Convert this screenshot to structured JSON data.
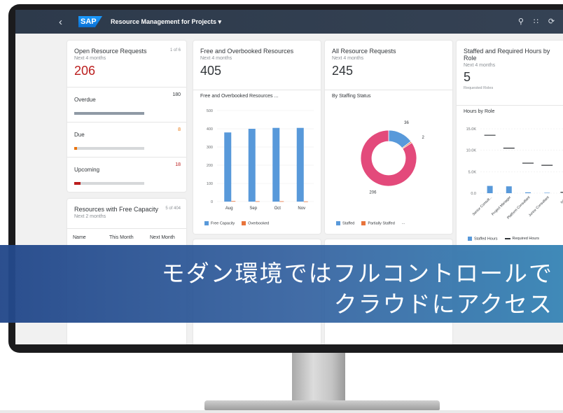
{
  "shell": {
    "back_label": "‹",
    "logo": "SAP",
    "app_title": "Resource Management for Projects ▾",
    "icons": [
      "search-icon",
      "grid-icon",
      "refresh-icon",
      "settings-icon"
    ]
  },
  "cards": {
    "open_requests": {
      "title": "Open Resource Requests",
      "counter": "1 of 6",
      "subtitle": "Next 4 months",
      "kpi": "206",
      "rows": [
        {
          "label": "Overdue",
          "value": "180",
          "fill": 1.0,
          "color": "#8f9aa5"
        },
        {
          "label": "Due",
          "value": "8",
          "fill": 0.04,
          "color": "#e9730c"
        },
        {
          "label": "Upcoming",
          "value": "18",
          "fill": 0.09,
          "color": "#bb1e1e"
        }
      ]
    },
    "free_overbooked": {
      "title": "Free and Overbooked Resources",
      "subtitle": "Next 4 months",
      "kpi": "405",
      "chart_title": "Free and Overbooked Resources ...",
      "legend": [
        "Free Capacity",
        "Overbooked"
      ],
      "legend_colors": [
        "#5899da",
        "#e8743b"
      ]
    },
    "all_requests": {
      "title": "All Resource Requests",
      "subtitle": "Next 4 months",
      "kpi": "245",
      "chart_title": "By Staffing Status",
      "legend": [
        "Staffed",
        "Partially Staffed",
        "..."
      ],
      "legend_colors": [
        "#5899da",
        "#e8743b"
      ]
    },
    "staffed_required": {
      "title": "Staffed and Required Hours by Role",
      "subtitle": "Next 4 months",
      "kpi": "5",
      "kpi_caption": "Requested Roles",
      "chart_title": "Hours by Role",
      "legend": [
        "Staffed Hours",
        "Required Hours"
      ]
    },
    "free_capacity": {
      "title": "Resources with Free Capacity",
      "counter": "5 of 404",
      "subtitle": "Next 2 months",
      "columns": [
        "Name",
        "This Month",
        "Next Month"
      ]
    }
  },
  "banner": {
    "line1": "モダン環境ではフルコントロールで",
    "line2": "クラウドにアクセス"
  },
  "chart_data": [
    {
      "type": "bar",
      "title": "Free and Overbooked Resources ...",
      "categories": [
        "Aug",
        "Sep",
        "Oct",
        "Nov"
      ],
      "series": [
        {
          "name": "Free Capacity",
          "values": [
            380,
            400,
            405,
            405
          ]
        },
        {
          "name": "Overbooked",
          "values": [
            3,
            2,
            2,
            1
          ]
        }
      ],
      "yticks": [
        "500",
        "400",
        "300",
        "200",
        "100",
        "0"
      ],
      "ylim": [
        0,
        500
      ]
    },
    {
      "type": "pie",
      "title": "By Staffing Status",
      "labels": [
        "Staffed",
        "Partially Staffed",
        "..."
      ],
      "values": [
        36,
        2,
        206
      ],
      "data_labels": [
        "36",
        "2",
        "206"
      ],
      "colors": [
        "#5899da",
        "#e8743b",
        "#e34a7b"
      ]
    },
    {
      "type": "bar",
      "title": "Hours by Role",
      "categories": [
        "Senior Consult...",
        "Project Manager",
        "Platform Consultant",
        "Junior Consultant",
        "Intern"
      ],
      "series": [
        {
          "name": "Staffed Hours",
          "values": [
            1700,
            1600,
            200,
            100,
            50
          ]
        },
        {
          "name": "Required Hours",
          "values": [
            13500,
            10500,
            7000,
            6500,
            200
          ]
        }
      ],
      "yticks": [
        "15.0K",
        "10.0K",
        "5.0K",
        "0.0"
      ],
      "ylim": [
        0,
        15000
      ]
    }
  ]
}
